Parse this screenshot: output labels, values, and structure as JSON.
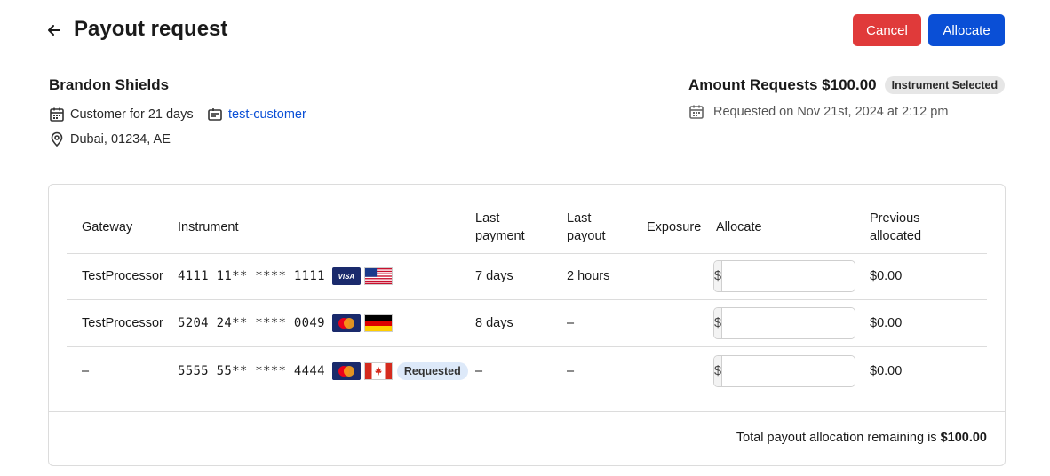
{
  "header": {
    "title": "Payout request",
    "cancel_label": "Cancel",
    "allocate_label": "Allocate"
  },
  "customer": {
    "name": "Brandon Shields",
    "since": "Customer for 21 days",
    "link_text": "test-customer",
    "location": "Dubai, 01234, AE"
  },
  "request": {
    "amount_label": "Amount Requests $100.00",
    "status_badge": "Instrument Selected",
    "requested_on": "Requested on Nov 21st, 2024 at 2:12 pm"
  },
  "table": {
    "headers": {
      "gateway": "Gateway",
      "instrument": "Instrument",
      "last_payment_1": "Last",
      "last_payment_2": "payment",
      "last_payout_1": "Last",
      "last_payout_2": "payout",
      "exposure": "Exposure",
      "allocate": "Allocate",
      "prev_1": "Previous",
      "prev_2": "allocated"
    },
    "currency_prefix": "$",
    "rows": [
      {
        "gateway": "TestProcessor",
        "instrument": "4111 11** **** 1111",
        "card_brand": "visa",
        "card_brand_text": "VISA",
        "flag": "us-flag",
        "badge": "",
        "last_payment": "7 days",
        "last_payout": "2 hours",
        "exposure": "",
        "allocate_value": "",
        "previous_allocated": "$0.00"
      },
      {
        "gateway": "TestProcessor",
        "instrument": "5204 24** **** 0049",
        "card_brand": "mastercard",
        "flag": "de-flag",
        "badge": "",
        "last_payment": "8 days",
        "last_payout": "–",
        "exposure": "",
        "allocate_value": "",
        "previous_allocated": "$0.00"
      },
      {
        "gateway": "–",
        "instrument": "5555 55** **** 4444",
        "card_brand": "mastercard",
        "flag": "ca-flag",
        "badge": "Requested",
        "last_payment": "–",
        "last_payout": "–",
        "exposure": "",
        "allocate_value": "",
        "previous_allocated": "$0.00"
      }
    ]
  },
  "footer": {
    "total_prefix": "Total payout allocation remaining is",
    "total_amount": "$100.00"
  },
  "colors": {
    "cancel": "#e03a3a",
    "allocate": "#0a4fd6",
    "link": "#0a4fd6",
    "requested_badge_bg": "#dde9f9",
    "selected_badge_bg": "#e6e6e6"
  }
}
